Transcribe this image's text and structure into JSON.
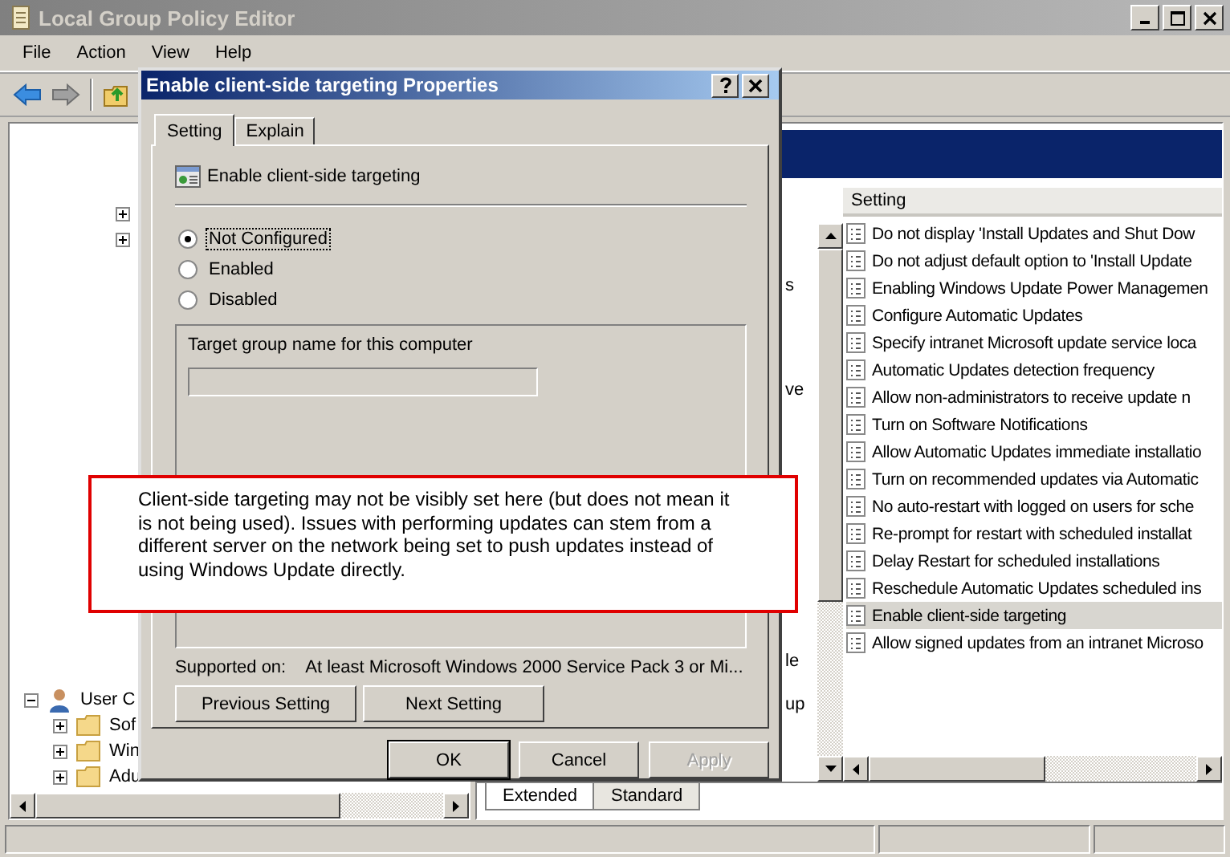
{
  "window": {
    "title": "Local Group Policy Editor",
    "active": false
  },
  "menu": [
    "File",
    "Action",
    "View",
    "Help"
  ],
  "tree": [
    {
      "expanded": false
    },
    {
      "expanded": false
    },
    {
      "label": "User C",
      "kind": "user",
      "expanded": true,
      "children": [
        {
          "label": "Sof",
          "kind": "folder",
          "expanded": false
        },
        {
          "label": "Win",
          "kind": "folder",
          "expanded": false
        },
        {
          "label": "Adu",
          "kind": "folder",
          "expanded": false
        }
      ]
    }
  ],
  "middle_pane_fragments": [
    "s",
    "ve",
    "le",
    "up"
  ],
  "settings_list": {
    "column": "Setting",
    "rows": [
      {
        "label": "Do not display 'Install Updates and Shut Dow",
        "selected": false
      },
      {
        "label": "Do not adjust default option to 'Install Update",
        "selected": false
      },
      {
        "label": "Enabling Windows Update Power Managemen",
        "selected": false
      },
      {
        "label": "Configure Automatic Updates",
        "selected": false
      },
      {
        "label": "Specify intranet Microsoft update service loca",
        "selected": false
      },
      {
        "label": "Automatic Updates detection frequency",
        "selected": false
      },
      {
        "label": "Allow non-administrators to receive update n",
        "selected": false
      },
      {
        "label": "Turn on Software Notifications",
        "selected": false
      },
      {
        "label": "Allow Automatic Updates immediate installatio",
        "selected": false
      },
      {
        "label": "Turn on recommended updates via Automatic",
        "selected": false
      },
      {
        "label": "No auto-restart with logged on users for sche",
        "selected": false
      },
      {
        "label": "Re-prompt for restart with scheduled installat",
        "selected": false
      },
      {
        "label": "Delay Restart for scheduled installations",
        "selected": false
      },
      {
        "label": "Reschedule Automatic Updates scheduled ins",
        "selected": false
      },
      {
        "label": "Enable client-side targeting",
        "selected": true
      },
      {
        "label": "Allow signed updates from an intranet Microso",
        "selected": false
      }
    ]
  },
  "view_tabs": [
    {
      "label": "Extended",
      "selected": true
    },
    {
      "label": "Standard",
      "selected": false
    }
  ],
  "dialog": {
    "title": "Enable client-side targeting Properties",
    "tabs": [
      {
        "label": "Setting",
        "selected": true
      },
      {
        "label": "Explain",
        "selected": false
      }
    ],
    "policy_name": "Enable client-side targeting",
    "options": [
      {
        "label": "Not Configured",
        "selected": true
      },
      {
        "label": "Enabled",
        "selected": false
      },
      {
        "label": "Disabled",
        "selected": false
      }
    ],
    "group_label": "Target group name for this computer",
    "target_field": {
      "disabled": true
    },
    "supported_label": "Supported on:",
    "supported_value": "At least Microsoft Windows 2000 Service Pack 3 or Mi...",
    "nav_buttons": [
      "Previous Setting",
      "Next Setting"
    ],
    "buttons": [
      {
        "label": "OK",
        "disabled": false
      },
      {
        "label": "Cancel",
        "disabled": false
      },
      {
        "label": "Apply",
        "disabled": true
      }
    ]
  },
  "annotation": {
    "text": "Client-side targeting may not be visibly set here (but does not mean it is not being used).  Issues with performing updates can stem from a different server on the network being set to push updates instead of using Windows Update directly."
  }
}
